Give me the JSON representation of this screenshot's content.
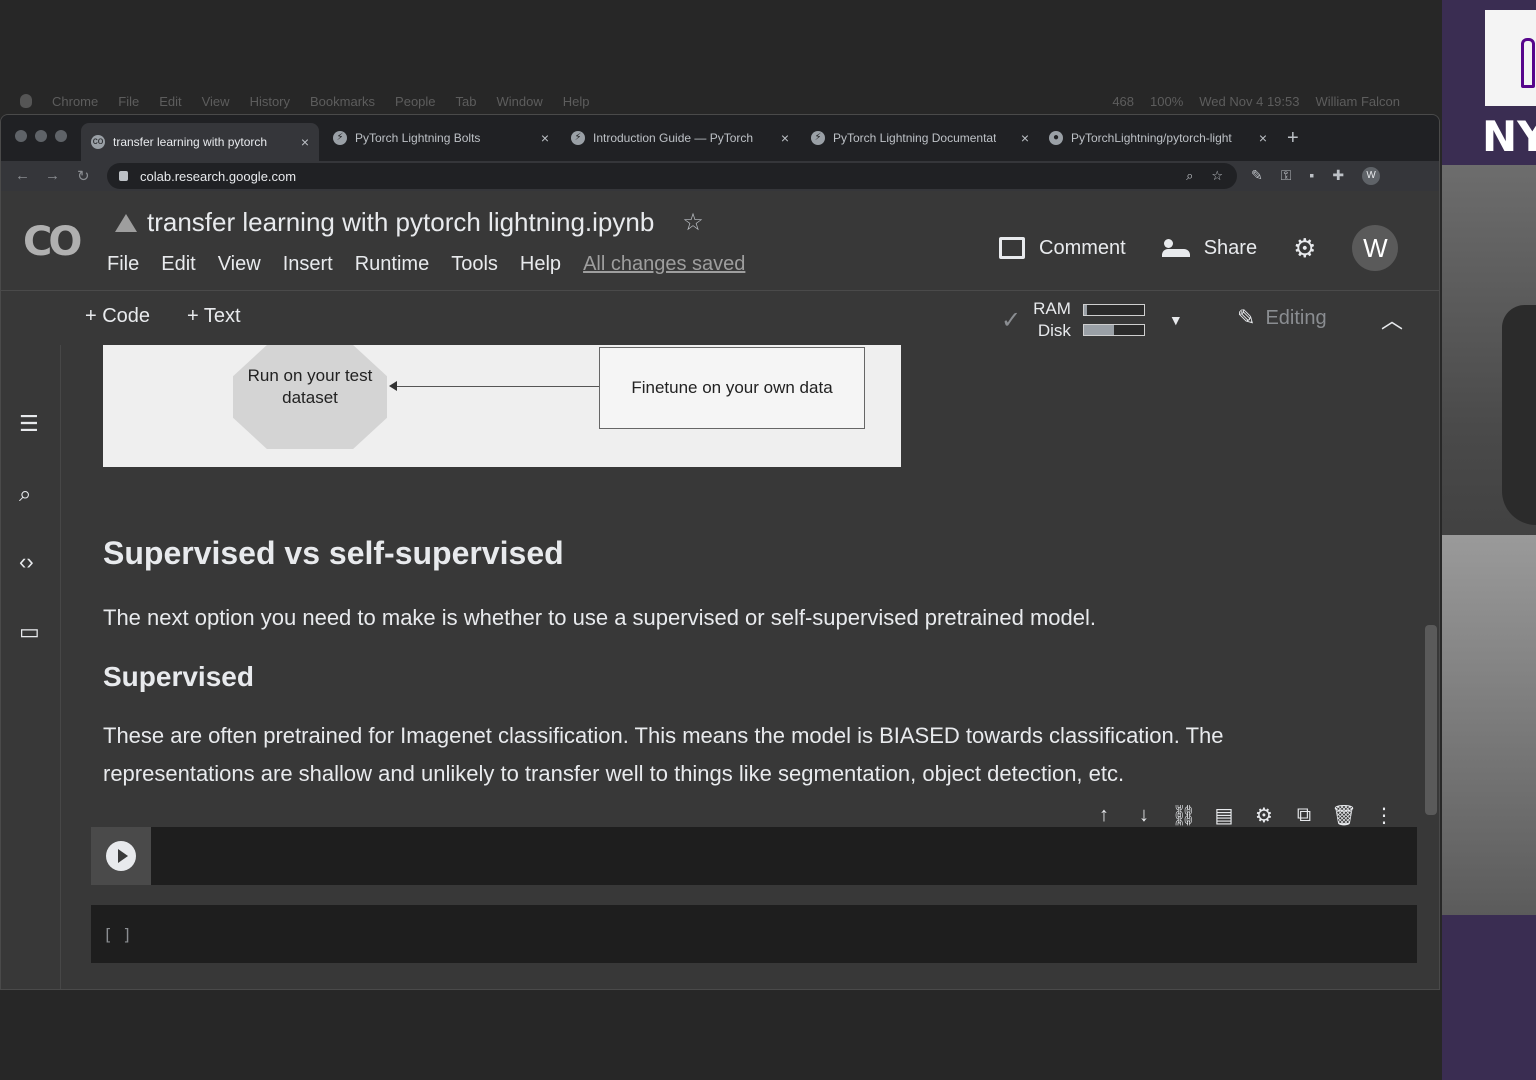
{
  "menubar": {
    "items": [
      "Chrome",
      "File",
      "Edit",
      "View",
      "History",
      "Bookmarks",
      "People",
      "Tab",
      "Window",
      "Help"
    ],
    "status": [
      "468",
      "100%",
      "Wed Nov 4  19:53",
      "William Falcon"
    ]
  },
  "browser": {
    "tabs": [
      {
        "title": "transfer learning with pytorch",
        "active": true
      },
      {
        "title": "PyTorch Lightning Bolts"
      },
      {
        "title": "Introduction Guide — PyTorch"
      },
      {
        "title": "PyTorch Lightning Documentat"
      },
      {
        "title": "PyTorchLightning/pytorch-light"
      }
    ],
    "url": "colab.research.google.com",
    "avatar_letter": "W"
  },
  "colab": {
    "logo": "CO",
    "notebook_title": "transfer learning with pytorch lightning.ipynb",
    "menu": [
      "File",
      "Edit",
      "View",
      "Insert",
      "Runtime",
      "Tools",
      "Help"
    ],
    "save_status": "All changes saved",
    "comment_label": "Comment",
    "share_label": "Share",
    "avatar_letter": "W",
    "add_code_label": "+ Code",
    "add_text_label": "+ Text",
    "ram_label": "RAM",
    "disk_label": "Disk",
    "ram_fraction": 0.05,
    "disk_fraction": 0.5,
    "editing_label": "Editing"
  },
  "diagram": {
    "octagon_text": "Run on your test dataset",
    "box_text": "Finetune on your own data"
  },
  "content": {
    "heading1": "Supervised vs self-supervised",
    "paragraph1": "The next option you need to make is whether to use a supervised or self-supervised pretrained model.",
    "heading2": "Supervised",
    "paragraph2": "These are often pretrained for Imagenet classification. This means the model is BIASED towards classification. The representations are shallow and unlikely to transfer well to things like segmentation, object detection, etc.",
    "exec_count": "[ ]"
  },
  "video": {
    "logo_text": "NY"
  }
}
